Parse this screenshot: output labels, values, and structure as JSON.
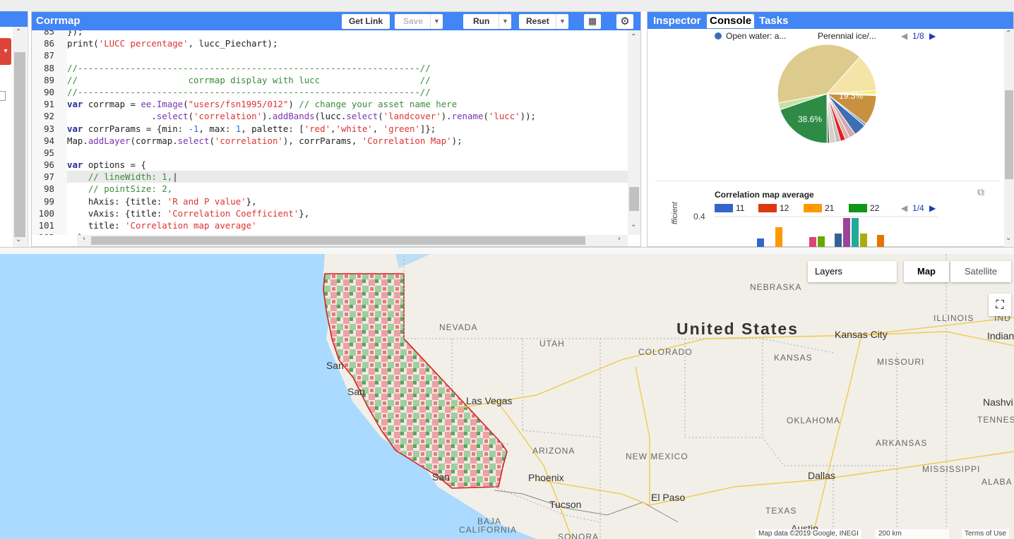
{
  "editor": {
    "title": "Corrmap",
    "buttons": {
      "get_link": "Get Link",
      "save": "Save",
      "run": "Run",
      "reset": "Reset"
    },
    "lines": [
      {
        "n": "85",
        "parts": [
          {
            "c": "plain",
            "t": "});"
          }
        ]
      },
      {
        "n": "86",
        "parts": [
          {
            "c": "plain",
            "t": "print("
          },
          {
            "c": "str",
            "t": "'LUCC percentage'"
          },
          {
            "c": "plain",
            "t": ", lucc_Piechart);"
          }
        ]
      },
      {
        "n": "87",
        "parts": []
      },
      {
        "n": "88",
        "parts": [
          {
            "c": "cmt",
            "t": "//-----------------------------------------------------------------//"
          }
        ]
      },
      {
        "n": "89",
        "parts": [
          {
            "c": "cmt",
            "t": "//                     corrmap display with lucc                   //"
          }
        ]
      },
      {
        "n": "90",
        "parts": [
          {
            "c": "cmt",
            "t": "//-----------------------------------------------------------------//"
          }
        ]
      },
      {
        "n": "91",
        "parts": [
          {
            "c": "kw",
            "t": "var"
          },
          {
            "c": "plain",
            "t": " corrmap = "
          },
          {
            "c": "mth",
            "t": "ee.Image"
          },
          {
            "c": "plain",
            "t": "("
          },
          {
            "c": "str",
            "t": "\"users/fsn1995/012\""
          },
          {
            "c": "plain",
            "t": ") "
          },
          {
            "c": "cmt",
            "t": "// change your asset name here"
          }
        ]
      },
      {
        "n": "92",
        "parts": [
          {
            "c": "plain",
            "t": "                ."
          },
          {
            "c": "mth",
            "t": "select"
          },
          {
            "c": "plain",
            "t": "("
          },
          {
            "c": "str",
            "t": "'correlation'"
          },
          {
            "c": "plain",
            "t": ")."
          },
          {
            "c": "mth",
            "t": "addBands"
          },
          {
            "c": "plain",
            "t": "(lucc."
          },
          {
            "c": "mth",
            "t": "select"
          },
          {
            "c": "plain",
            "t": "("
          },
          {
            "c": "str",
            "t": "'landcover'"
          },
          {
            "c": "plain",
            "t": ")."
          },
          {
            "c": "mth",
            "t": "rename"
          },
          {
            "c": "plain",
            "t": "("
          },
          {
            "c": "str",
            "t": "'lucc'"
          },
          {
            "c": "plain",
            "t": "));"
          }
        ]
      },
      {
        "n": "93",
        "parts": [
          {
            "c": "kw",
            "t": "var"
          },
          {
            "c": "plain",
            "t": " corrParams = {min: "
          },
          {
            "c": "num",
            "t": "-1"
          },
          {
            "c": "plain",
            "t": ", max: "
          },
          {
            "c": "num",
            "t": "1"
          },
          {
            "c": "plain",
            "t": ", palette: ["
          },
          {
            "c": "str",
            "t": "'red'"
          },
          {
            "c": "plain",
            "t": ","
          },
          {
            "c": "str",
            "t": "'white'"
          },
          {
            "c": "plain",
            "t": ", "
          },
          {
            "c": "str",
            "t": "'green'"
          },
          {
            "c": "plain",
            "t": "]};"
          }
        ]
      },
      {
        "n": "94",
        "parts": [
          {
            "c": "plain",
            "t": "Map."
          },
          {
            "c": "mth",
            "t": "addLayer"
          },
          {
            "c": "plain",
            "t": "(corrmap."
          },
          {
            "c": "mth",
            "t": "select"
          },
          {
            "c": "plain",
            "t": "("
          },
          {
            "c": "str",
            "t": "'correlation'"
          },
          {
            "c": "plain",
            "t": "), corrParams, "
          },
          {
            "c": "str",
            "t": "'Correlation Map'"
          },
          {
            "c": "plain",
            "t": ");"
          }
        ]
      },
      {
        "n": "95",
        "parts": []
      },
      {
        "n": "96",
        "parts": [
          {
            "c": "kw",
            "t": "var"
          },
          {
            "c": "plain",
            "t": " options = {"
          }
        ]
      },
      {
        "n": "97",
        "cur": true,
        "parts": [
          {
            "c": "cmt",
            "t": "    // lineWidth: 1,"
          },
          {
            "c": "plain",
            "t": "|"
          }
        ]
      },
      {
        "n": "98",
        "parts": [
          {
            "c": "cmt",
            "t": "    // pointSize: 2,"
          }
        ]
      },
      {
        "n": "99",
        "parts": [
          {
            "c": "plain",
            "t": "    hAxis: {title: "
          },
          {
            "c": "str",
            "t": "'R and P value'"
          },
          {
            "c": "plain",
            "t": "},"
          }
        ]
      },
      {
        "n": "100",
        "parts": [
          {
            "c": "plain",
            "t": "    vAxis: {title: "
          },
          {
            "c": "str",
            "t": "'Correlation Coefficient'"
          },
          {
            "c": "plain",
            "t": "},"
          }
        ]
      },
      {
        "n": "101",
        "parts": [
          {
            "c": "plain",
            "t": "    title: "
          },
          {
            "c": "str",
            "t": "'Correlation map average'"
          }
        ]
      },
      {
        "n": "102",
        "parts": [
          {
            "c": "plain",
            "t": "  }"
          }
        ]
      }
    ]
  },
  "right_panel": {
    "tabs": [
      "Inspector",
      "Console",
      "Tasks"
    ],
    "active_tab": "Console",
    "pie": {
      "legend": [
        "Open water: a...",
        "Perennial ice/..."
      ],
      "pager": "1/8",
      "labels": [
        "19.3%",
        "38.6%"
      ],
      "slices": [
        {
          "value": 38.6,
          "color": "#dccb8c"
        },
        {
          "value": 12.0,
          "color": "#f4e4a8"
        },
        {
          "value": 1.0,
          "color": "#f6f04a"
        },
        {
          "value": 0.6,
          "color": "#e8e8e8"
        },
        {
          "value": 9.6,
          "color": "#c7913f"
        },
        {
          "value": 0.7,
          "color": "#5b8ed6"
        },
        {
          "value": 4.0,
          "color": "#3d6eb0"
        },
        {
          "value": 2.0,
          "color": "#d6a8b0"
        },
        {
          "value": 1.5,
          "color": "#e0b0b0"
        },
        {
          "value": 1.6,
          "color": "#e02020"
        },
        {
          "value": 1.5,
          "color": "#c0c0c0"
        },
        {
          "value": 2.0,
          "color": "#d7d0c8"
        },
        {
          "value": 0.8,
          "color": "#5c7a5c"
        },
        {
          "value": 19.3,
          "color": "#2e8b45"
        },
        {
          "value": 2.2,
          "color": "#c8e0a8"
        }
      ]
    },
    "bar_chart": {
      "title": "Correlation map average",
      "legend": [
        {
          "name": "11",
          "color": "#3366cc"
        },
        {
          "name": "12",
          "color": "#dc3912"
        },
        {
          "name": "21",
          "color": "#ff9900"
        },
        {
          "name": "22",
          "color": "#109618"
        }
      ],
      "pager": "1/4",
      "ytick": "0.4",
      "ylabel_partial": "fficient"
    }
  },
  "map": {
    "layers_label": "Layers",
    "map_btn": "Map",
    "satellite_btn": "Satellite",
    "labels": [
      {
        "t": "NEBRASKA",
        "k": "state"
      },
      {
        "t": "United States",
        "k": "country"
      },
      {
        "t": "NEVADA",
        "k": "state"
      },
      {
        "t": "UTAH",
        "k": "state"
      },
      {
        "t": "COLORADO",
        "k": "state"
      },
      {
        "t": "KANSAS",
        "k": "state"
      },
      {
        "t": "MISSOURI",
        "k": "state"
      },
      {
        "t": "ILLINOIS",
        "k": "state"
      },
      {
        "t": "IND",
        "k": "state"
      },
      {
        "t": "Kansas City",
        "k": "city"
      },
      {
        "t": "Indian",
        "k": "city"
      },
      {
        "t": "San",
        "k": "city"
      },
      {
        "t": "San",
        "k": "city"
      },
      {
        "t": "Las Vegas",
        "k": "city"
      },
      {
        "t": "OKLAHOMA",
        "k": "state"
      },
      {
        "t": "Nashvi",
        "k": "city"
      },
      {
        "t": "TENNES",
        "k": "state"
      },
      {
        "t": "ARIZONA",
        "k": "state"
      },
      {
        "t": "NEW MEXICO",
        "k": "state"
      },
      {
        "t": "ARKANSAS",
        "k": "state"
      },
      {
        "t": "San",
        "k": "city"
      },
      {
        "t": "Phoenix",
        "k": "city"
      },
      {
        "t": "MISSISSIPPI",
        "k": "state"
      },
      {
        "t": "Dallas",
        "k": "city"
      },
      {
        "t": "ALABA",
        "k": "state"
      },
      {
        "t": "El Paso",
        "k": "city"
      },
      {
        "t": "Tucson",
        "k": "city"
      },
      {
        "t": "TEXAS",
        "k": "state"
      },
      {
        "t": "BAJA",
        "k": "state"
      },
      {
        "t": "CALIFORNIA",
        "k": "state"
      },
      {
        "t": "SONORA",
        "k": "state"
      },
      {
        "t": "Austin",
        "k": "city"
      }
    ],
    "footer": {
      "data": "Map data ©2019 Google, INEGI",
      "scale": "200 km",
      "terms": "Terms of Use"
    }
  }
}
